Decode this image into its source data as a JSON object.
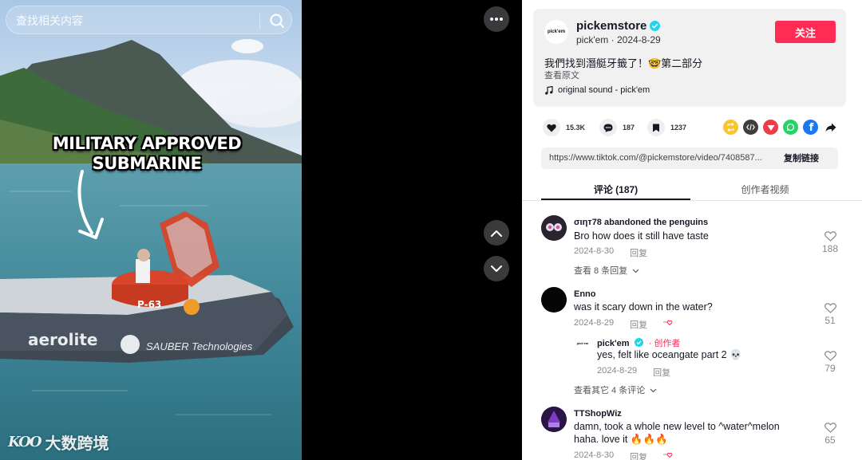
{
  "search": {
    "placeholder": "查找相关内容"
  },
  "video": {
    "overlay_line1": "MILITARY APPROVED",
    "overlay_line2": "SUBMARINE",
    "boat_brand": "aerolite",
    "boat_sponsor": "SAUBER Technologies",
    "hull_number": "P-63",
    "watermark_logo": "KOO",
    "watermark_text": "大数跨境"
  },
  "author": {
    "name": "pickemstore",
    "handle": "pick'em",
    "date": "2024-8-29",
    "avatar_text": "pick'em",
    "follow_label": "关注",
    "description": "我們找到潛艇牙籤了！🤓第二部分",
    "see_original": "查看原文",
    "sound": "original sound - pick'em"
  },
  "stats": {
    "likes": "15.3K",
    "comments": "187",
    "saves": "1237"
  },
  "share_icons": [
    "repost-icon",
    "embed-icon",
    "send-icon",
    "whatsapp-icon",
    "facebook-icon",
    "share-arrow-icon"
  ],
  "link": {
    "url": "https://www.tiktok.com/@pickemstore/video/7408587...",
    "copy_label": "复制链接"
  },
  "tabs": [
    {
      "label": "评论 (187)"
    },
    {
      "label": "创作者视频"
    }
  ],
  "comments": [
    {
      "user": "σιηт78 abandoned the penguins",
      "text": "Bro how does it still have taste",
      "date": "2024-8-30",
      "reply": "回复",
      "likes": "188",
      "more": "查看 8 条回复"
    },
    {
      "user": "Enno",
      "text": "was it scary down in the water?",
      "date": "2024-8-29",
      "reply": "回复",
      "likes": "51",
      "reply_item": {
        "user": "pick'em",
        "tag": "· 创作者",
        "text": "yes, felt like oceangate part 2 💀",
        "date": "2024-8-29",
        "reply": "回复",
        "likes": "79",
        "avatar_text": "pick'em"
      },
      "more": "查看其它 4 条评论"
    },
    {
      "user": "TTShopWiz",
      "text": "damn, took a whole new level to ^water^melon",
      "text2": "haha. love it 🔥🔥🔥",
      "date": "2024-8-30",
      "reply": "回复",
      "likes": "65"
    }
  ],
  "colors": {
    "follow": "#fe2c55",
    "verified": "#20d5ec",
    "text": "#161823"
  }
}
